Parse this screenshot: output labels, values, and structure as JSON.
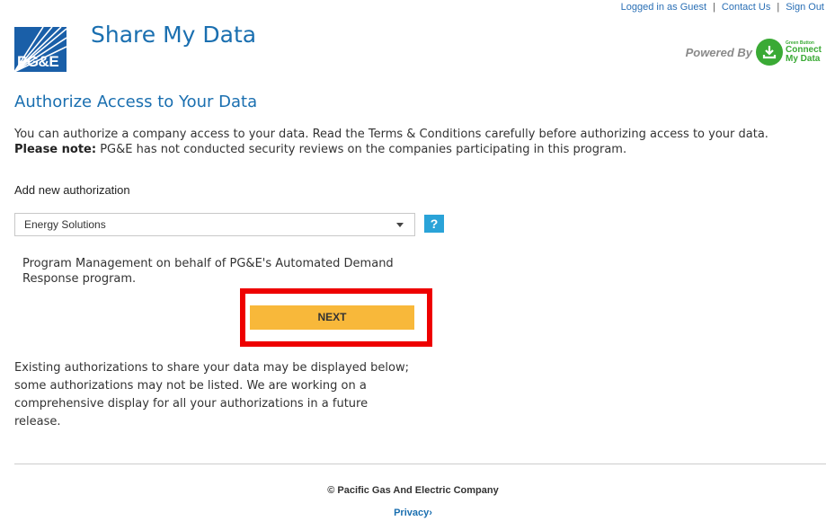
{
  "header": {
    "top_links": {
      "logged_in": "Logged in as Guest",
      "separator": "|",
      "contact": "Contact Us",
      "sign_out": "Sign Out"
    },
    "logo_text": "PG&E",
    "app_title": "Share My Data",
    "powered_by": {
      "label": "Powered By",
      "badge_small": "Green Button",
      "badge_line1": "Connect",
      "badge_line2": "My Data"
    }
  },
  "main": {
    "heading": "Authorize Access to Your Data",
    "intro_line1": "You can authorize a company access to your data. Read the Terms & Conditions carefully before authorizing access to your data.",
    "note_label": "Please note:",
    "note_text": " PG&E has not conducted security reviews on the companies participating in this program.",
    "add_label": "Add new authorization",
    "select": {
      "selected": "Energy Solutions"
    },
    "help_label": "?",
    "program_description": "Program Management on behalf of PG&E's Automated Demand Response program.",
    "next_label": "NEXT",
    "existing_text": "Existing authorizations to share your data may be displayed below; some authorizations may not be listed. We are working on a comprehensive display for all your authorizations in a future release."
  },
  "footer": {
    "copyright": "© Pacific Gas And Electric Company",
    "privacy": "Privacy›"
  },
  "colors": {
    "brand_blue": "#1a6fb0",
    "logo_blue": "#1a5fa8",
    "next_button": "#f8b83a",
    "highlight_red": "#ee0000",
    "green_button": "#3aaa35",
    "help_blue": "#2aa3d8"
  }
}
